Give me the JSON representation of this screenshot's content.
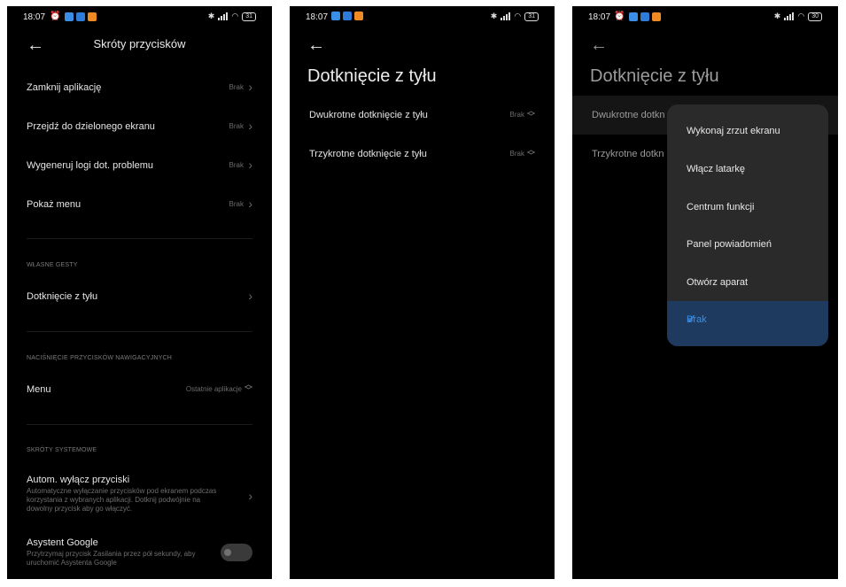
{
  "colors": {
    "phone_bg": "#000000",
    "accent": "#3a8ee6",
    "dropdown_bg": "#2a2a2a",
    "selected_bg": "#1e3a5f"
  },
  "status": {
    "time": "18:07",
    "battery_1": "31",
    "battery_2": "31",
    "battery_3": "30"
  },
  "screen1": {
    "title": "Skróty przycisków",
    "rows": [
      {
        "label": "Zamknij aplikację",
        "value": "Brak"
      },
      {
        "label": "Przejdź do dzielonego ekranu",
        "value": "Brak"
      },
      {
        "label": "Wygeneruj logi dot. problemu",
        "value": "Brak"
      },
      {
        "label": "Pokaż menu",
        "value": "Brak"
      }
    ],
    "section_gestures": "WŁASNE GESTY",
    "back_tap_label": "Dotknięcie z tyłu",
    "section_nav": "NACIŚNIĘCIE PRZYCISKÓW NAWIGACYJNYCH",
    "menu_label": "Menu",
    "menu_value": "Ostatnie aplikacje",
    "section_system": "SKRÓTY SYSTEMOWE",
    "auto_off_title": "Autom. wyłącz przyciski",
    "auto_off_desc": "Automatyczne wyłączanie przycisków pod ekranem podczas korzystania z wybranych aplikacji. Dotknij podwójnie na dowolny przycisk aby go włączyć.",
    "assistant_title": "Asystent Google",
    "assistant_desc": "Przytrzymaj przycisk Zasilania przez pół sekundy, aby uruchomić Asystenta Google"
  },
  "screen2": {
    "title": "Dotknięcie z tyłu",
    "rows": [
      {
        "label": "Dwukrotne dotknięcie z tyłu",
        "value": "Brak"
      },
      {
        "label": "Trzykrotne dotknięcie z tyłu",
        "value": "Brak"
      }
    ]
  },
  "screen3": {
    "title": "Dotknięcie z tyłu",
    "row1_label": "Dwukrotne dotkn",
    "row2_label": "Trzykrotne dotkn",
    "options": [
      "Wykonaj zrzut ekranu",
      "Włącz latarkę",
      "Centrum funkcji",
      "Panel powiadomień",
      "Otwórz aparat",
      "Brak"
    ],
    "selected_option": "Brak"
  }
}
